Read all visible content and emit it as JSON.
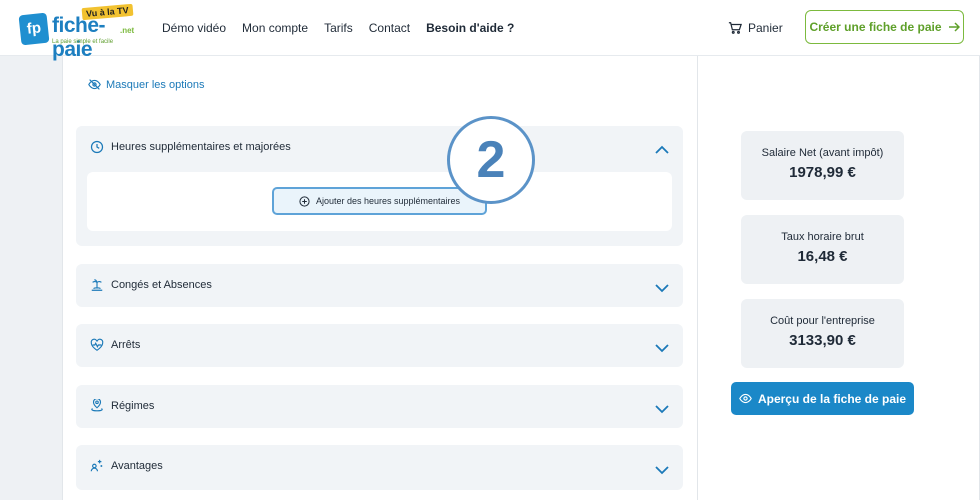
{
  "header": {
    "logo": {
      "mark": "fp",
      "name": "fiche-paie",
      "badge": "Vu à la TV",
      "suffix": ".net",
      "tagline": "La paie simple et facile"
    },
    "nav": [
      "Démo vidéo",
      "Mon compte",
      "Tarifs",
      "Contact",
      "Besoin d'aide ?"
    ],
    "cart": "Panier",
    "create_button": "Créer une fiche de paie"
  },
  "options": {
    "hide_label": "Masquer les options"
  },
  "sections": [
    {
      "title": "Heures supplémentaires et majorées",
      "expanded": true,
      "icon": "clock-icon",
      "action": "Ajouter des heures supplémentaires"
    },
    {
      "title": "Congés et Absences",
      "expanded": false,
      "icon": "beach-icon"
    },
    {
      "title": "Arrêts",
      "expanded": false,
      "icon": "heart-pulse-icon"
    },
    {
      "title": "Régimes",
      "expanded": false,
      "icon": "location-pin-icon"
    },
    {
      "title": "Avantages",
      "expanded": false,
      "icon": "sparkle-people-icon"
    }
  ],
  "step_badge": "2",
  "summary": [
    {
      "label": "Salaire Net (avant impôt)",
      "value": "1978,99 €"
    },
    {
      "label": "Taux horaire brut",
      "value": "16,48 €"
    },
    {
      "label": "Coût pour l'entreprise",
      "value": "3133,90 €"
    }
  ],
  "preview_button": "Aperçu de la fiche de paie",
  "colors": {
    "accent": "#1b88c8",
    "brand_green": "#7cba3e",
    "panel": "#f1f4f7"
  }
}
